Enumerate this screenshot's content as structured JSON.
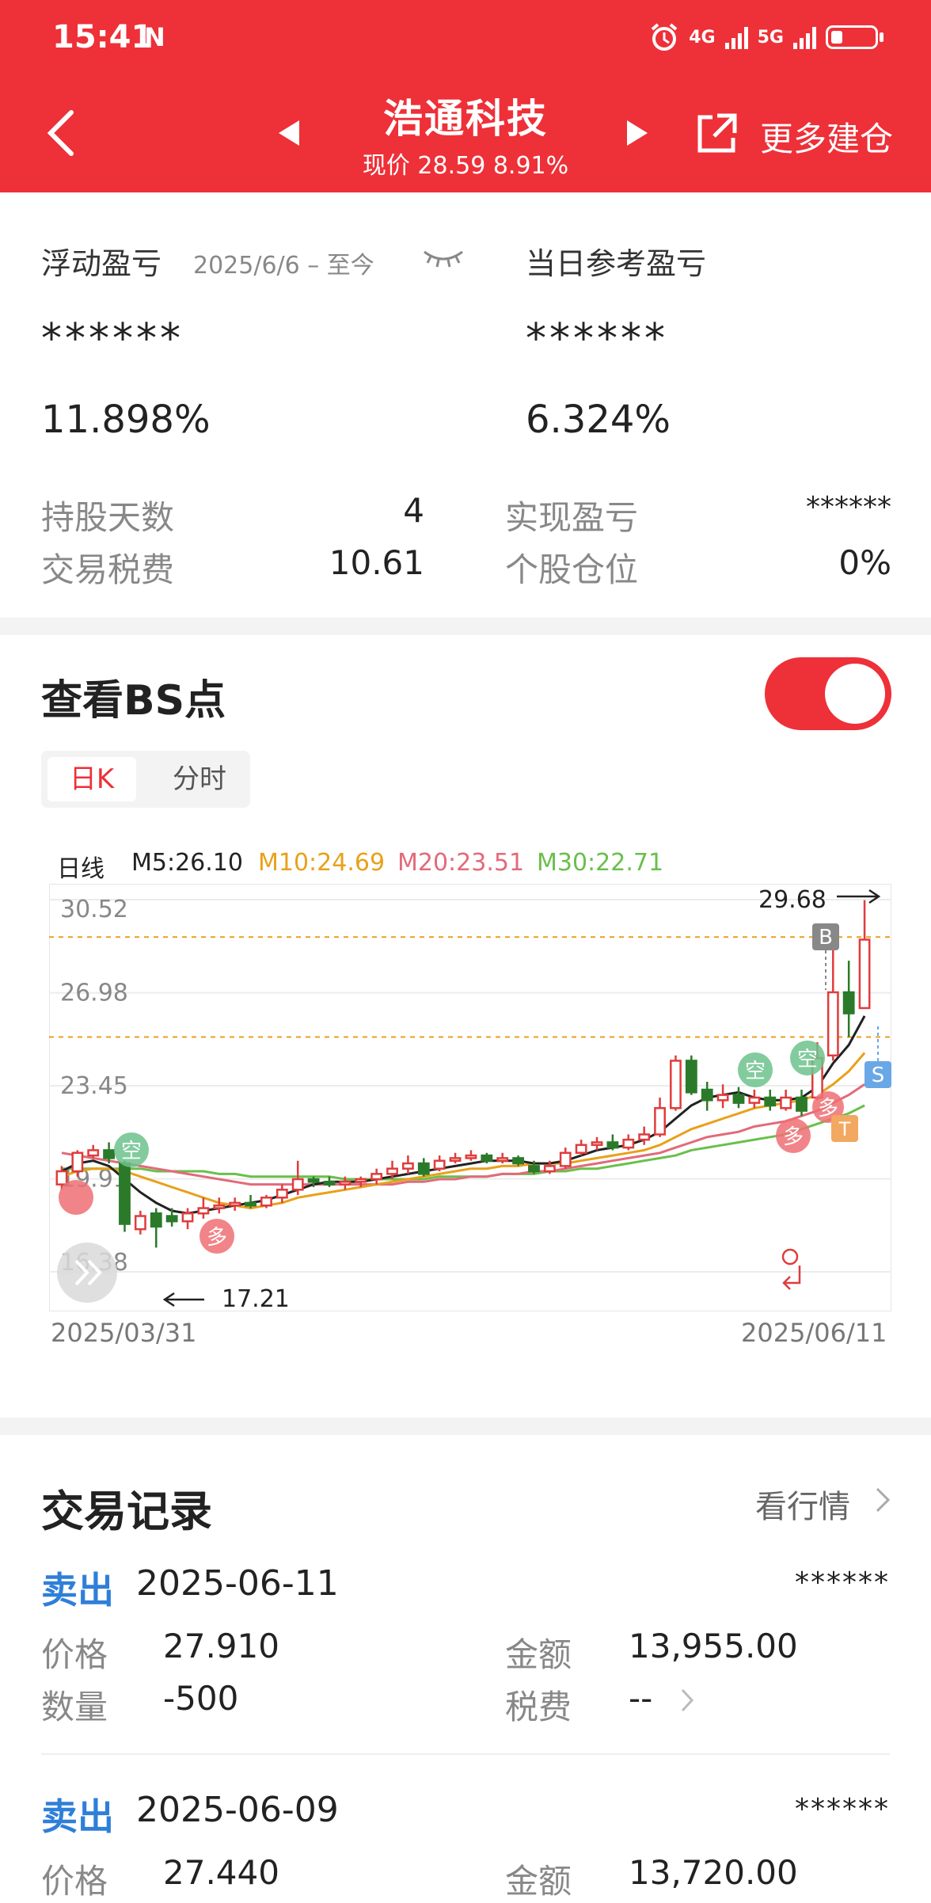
{
  "status_bar": {
    "time": "15:41",
    "nfc": "N",
    "net1": "4G",
    "net2": "5G"
  },
  "header": {
    "title": "浩通科技",
    "price_line": "现价 28.59 8.91%",
    "more_label": "更多建仓"
  },
  "summary": {
    "floating_label": "浮动盈亏",
    "floating_period": "2025/6/6 – 至今",
    "floating_amount": "******",
    "floating_pct": "11.898%",
    "daily_label": "当日参考盈亏",
    "daily_amount": "******",
    "daily_pct": "6.324%",
    "hold_days_label": "持股天数",
    "hold_days": "4",
    "realized_label": "实现盈亏",
    "realized": "******",
    "tax_label": "交易税费",
    "tax": "10.61",
    "position_label": "个股仓位",
    "position": "0%"
  },
  "bs": {
    "title": "查看BS点",
    "tab_day": "日K",
    "tab_time": "分时",
    "legend": {
      "label": "日线",
      "m5": "M5:26.10",
      "m10": "M10:24.69",
      "m20": "M20:23.51",
      "m30": "M30:22.71"
    },
    "start_date": "2025/03/31",
    "end_date": "2025/06/11",
    "colors": {
      "up": "#e03c3c",
      "down": "#2a7a2a",
      "m5": "#222222",
      "m10": "#e8a11a",
      "m20": "#e26a7a",
      "m30": "#6abf4b"
    }
  },
  "chart_data": {
    "type": "candlestick",
    "y_ticks": [
      "30.52",
      "26.98",
      "23.45",
      "19.91",
      "16.38"
    ],
    "ylim": [
      16.38,
      30.52
    ],
    "high_label": "29.68",
    "low_label": "17.21",
    "candles": [
      [
        19.7,
        20.2,
        19.5,
        20.4
      ],
      [
        20.2,
        20.9,
        20.0,
        21.0
      ],
      [
        20.8,
        21.0,
        20.7,
        21.2
      ],
      [
        21.0,
        20.7,
        20.5,
        21.3
      ],
      [
        20.5,
        18.2,
        17.9,
        20.6
      ],
      [
        18.0,
        18.5,
        17.8,
        18.7
      ],
      [
        18.6,
        18.1,
        17.3,
        18.8
      ],
      [
        18.5,
        18.3,
        18.1,
        18.8
      ],
      [
        18.3,
        18.6,
        18.0,
        18.8
      ],
      [
        18.6,
        18.8,
        18.4,
        19.2
      ],
      [
        18.8,
        18.9,
        18.6,
        19.2
      ],
      [
        18.9,
        19.0,
        18.7,
        19.2
      ],
      [
        19.0,
        18.9,
        18.8,
        19.3
      ],
      [
        18.9,
        19.2,
        18.8,
        19.3
      ],
      [
        19.2,
        19.5,
        19.0,
        19.7
      ],
      [
        19.5,
        19.9,
        19.3,
        20.6
      ],
      [
        19.9,
        19.8,
        19.6,
        20.0
      ],
      [
        19.8,
        19.7,
        19.6,
        20.0
      ],
      [
        19.7,
        19.8,
        19.5,
        20.0
      ],
      [
        19.8,
        19.9,
        19.6,
        20.0
      ],
      [
        19.9,
        20.1,
        19.7,
        20.3
      ],
      [
        20.1,
        20.3,
        19.9,
        20.6
      ],
      [
        20.3,
        20.5,
        20.1,
        20.8
      ],
      [
        20.5,
        20.1,
        20.0,
        20.7
      ],
      [
        20.3,
        20.6,
        20.2,
        20.8
      ],
      [
        20.6,
        20.7,
        20.5,
        20.9
      ],
      [
        20.7,
        20.8,
        20.6,
        21.0
      ],
      [
        20.8,
        20.6,
        20.5,
        20.9
      ],
      [
        20.6,
        20.7,
        20.5,
        20.9
      ],
      [
        20.7,
        20.5,
        20.4,
        20.8
      ],
      [
        20.4,
        20.2,
        20.1,
        20.6
      ],
      [
        20.2,
        20.4,
        20.1,
        20.6
      ],
      [
        20.4,
        20.9,
        20.3,
        21.1
      ],
      [
        20.9,
        21.2,
        20.8,
        21.4
      ],
      [
        21.2,
        21.3,
        21.0,
        21.5
      ],
      [
        21.3,
        21.1,
        21.0,
        21.6
      ],
      [
        21.1,
        21.4,
        21.0,
        21.6
      ],
      [
        21.4,
        21.6,
        21.2,
        21.9
      ],
      [
        21.6,
        22.6,
        21.5,
        23.0
      ],
      [
        22.6,
        24.4,
        22.5,
        24.6
      ],
      [
        24.4,
        23.2,
        23.1,
        24.6
      ],
      [
        23.3,
        22.9,
        22.5,
        23.6
      ],
      [
        22.9,
        23.1,
        22.6,
        23.5
      ],
      [
        23.1,
        22.8,
        22.6,
        23.4
      ],
      [
        22.8,
        23.0,
        22.6,
        23.3
      ],
      [
        23.0,
        22.7,
        22.5,
        23.3
      ],
      [
        22.6,
        23.0,
        22.5,
        23.3
      ],
      [
        23.0,
        22.5,
        22.3,
        23.3
      ],
      [
        23.0,
        24.5,
        22.9,
        25.1
      ],
      [
        24.6,
        27.0,
        24.4,
        28.6
      ],
      [
        27.0,
        26.2,
        25.3,
        28.2
      ],
      [
        26.4,
        29.0,
        26.4,
        30.5
      ]
    ],
    "m5": [
      20.2,
      20.5,
      20.6,
      20.4,
      19.9,
      19.4,
      19.0,
      18.7,
      18.6,
      18.7,
      18.8,
      18.9,
      19.0,
      19.1,
      19.3,
      19.5,
      19.7,
      19.8,
      19.8,
      19.8,
      19.9,
      20.0,
      20.1,
      20.2,
      20.3,
      20.4,
      20.5,
      20.6,
      20.6,
      20.6,
      20.5,
      20.5,
      20.6,
      20.8,
      21.0,
      21.1,
      21.2,
      21.4,
      21.7,
      22.2,
      22.7,
      23.0,
      23.1,
      23.2,
      23.0,
      22.9,
      22.9,
      23.0,
      23.4,
      24.3,
      25.0,
      26.1
    ],
    "m10": [
      20.0,
      20.2,
      20.3,
      20.3,
      20.2,
      20.0,
      19.8,
      19.6,
      19.4,
      19.2,
      19.0,
      18.9,
      18.8,
      18.9,
      19.0,
      19.2,
      19.3,
      19.4,
      19.5,
      19.6,
      19.7,
      19.8,
      19.9,
      20.0,
      20.1,
      20.2,
      20.3,
      20.3,
      20.4,
      20.4,
      20.5,
      20.5,
      20.5,
      20.6,
      20.7,
      20.8,
      20.9,
      21.0,
      21.2,
      21.5,
      21.8,
      22.0,
      22.2,
      22.4,
      22.6,
      22.7,
      22.8,
      22.9,
      23.1,
      23.5,
      24.0,
      24.7
    ],
    "m20": [
      20.9,
      20.8,
      20.7,
      20.6,
      20.5,
      20.4,
      20.3,
      20.2,
      20.1,
      20.0,
      19.9,
      19.8,
      19.7,
      19.7,
      19.7,
      19.7,
      19.7,
      19.7,
      19.7,
      19.7,
      19.7,
      19.7,
      19.8,
      19.8,
      19.9,
      19.9,
      20.0,
      20.0,
      20.1,
      20.1,
      20.2,
      20.2,
      20.3,
      20.4,
      20.5,
      20.6,
      20.7,
      20.8,
      20.9,
      21.1,
      21.3,
      21.5,
      21.6,
      21.7,
      21.9,
      22.0,
      22.1,
      22.3,
      22.5,
      22.8,
      23.1,
      23.5
    ],
    "m30": [
      20.3,
      20.3,
      20.3,
      20.3,
      20.3,
      20.3,
      20.2,
      20.2,
      20.2,
      20.2,
      20.1,
      20.1,
      20.0,
      20.0,
      20.0,
      20.0,
      20.0,
      20.0,
      19.9,
      19.9,
      19.9,
      19.9,
      19.9,
      19.9,
      20.0,
      20.0,
      20.0,
      20.0,
      20.1,
      20.1,
      20.1,
      20.2,
      20.2,
      20.3,
      20.3,
      20.4,
      20.5,
      20.6,
      20.7,
      20.8,
      21.0,
      21.1,
      21.2,
      21.3,
      21.4,
      21.5,
      21.6,
      21.8,
      22.0,
      22.2,
      22.4,
      22.7
    ]
  },
  "records": {
    "title": "交易记录",
    "view_market": "看行情",
    "items": [
      {
        "type": "卖出",
        "date": "2025-06-11",
        "amount_masked": "******",
        "price_label": "价格",
        "price": "27.910",
        "total_label": "金额",
        "total": "13,955.00",
        "qty_label": "数量",
        "qty": "-500",
        "fee_label": "税费",
        "fee": "--"
      },
      {
        "type": "卖出",
        "date": "2025-06-09",
        "amount_masked": "******",
        "price_label": "价格",
        "price": "27.440",
        "total_label": "金额",
        "total": "13,720.00"
      }
    ]
  }
}
